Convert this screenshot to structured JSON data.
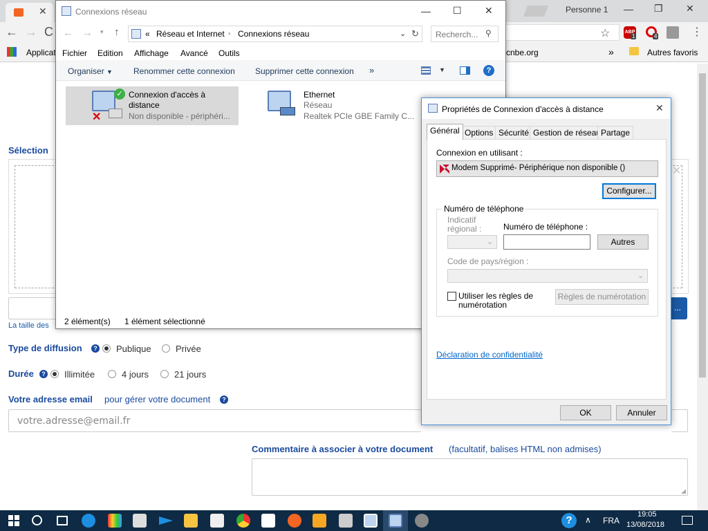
{
  "browser": {
    "profile_name": "Personne 1",
    "bookmarks": {
      "apps_label": "Applicat",
      "partial_bookmark": "cnbe.org",
      "more_chevron": "»",
      "other_bookmarks": "Autres favoris"
    },
    "extensions": {
      "abp_label": "ABP",
      "abp_badge": "1",
      "ext2_badge": "4"
    }
  },
  "webpage": {
    "select_label_partial": "Sélection",
    "size_note_partial": "La taille des",
    "browse_button_partial": "...",
    "diffusion": {
      "label": "Type de diffusion",
      "options": [
        "Publique",
        "Privée"
      ],
      "selected": "Publique"
    },
    "duration": {
      "label": "Durée",
      "options": [
        "Illimitée",
        "4 jours",
        "21 jours"
      ],
      "selected": "Illimitée"
    },
    "email": {
      "label": "Votre adresse email",
      "label_suffix": "pour gérer votre document",
      "placeholder": "votre.adresse@email.fr"
    },
    "comment": {
      "label": "Commentaire à associer à votre document",
      "label_suffix": "(facultatif, balises HTML non admises)"
    }
  },
  "explorer": {
    "title": "Connexions réseau",
    "breadcrumb": {
      "overflow": "«",
      "parts": [
        "Réseau et Internet",
        "Connexions réseau"
      ]
    },
    "search_placeholder": "Recherch...",
    "menu": [
      "Fichier",
      "Edition",
      "Affichage",
      "Avancé",
      "Outils"
    ],
    "commands": {
      "organize": "Organiser",
      "rename": "Renommer cette connexion",
      "delete": "Supprimer cette connexion",
      "more": "»"
    },
    "items": [
      {
        "title_line1": "Connexion d'accès à",
        "title_line2": "distance",
        "status": "Non disponible - périphéri..."
      },
      {
        "title_line1": "Ethernet",
        "status": "Réseau",
        "device": "Realtek PCIe GBE Family C..."
      }
    ],
    "status_bar": {
      "count": "2 élément(s)",
      "selected": "1 élément sélectionné"
    }
  },
  "dialog": {
    "title": "Propriétés de Connexion d'accès à distance",
    "tabs": [
      "Général",
      "Options",
      "Sécurité",
      "Gestion de réseau",
      "Partage"
    ],
    "active_tab": "Général",
    "connect_using_label": "Connexion en utilisant :",
    "device": "Modem Supprimé- Périphérique non disponible ()",
    "configure_button": "Configurer...",
    "phone_group": {
      "legend": "Numéro de téléphone",
      "area_code_label_line1": "Indicatif",
      "area_code_label_line2": "régional :",
      "phone_label": "Numéro de téléphone :",
      "phone_value": "",
      "others_button": "Autres",
      "country_label": "Code de pays/région :",
      "use_rules_line1": "Utiliser les règles de",
      "use_rules_line2": "numérotation",
      "use_rules_checked": false,
      "rules_button": "Règles de numérotation"
    },
    "privacy_link": "Déclaration de confidentialité",
    "ok_button": "OK",
    "cancel_button": "Annuler"
  },
  "taskbar": {
    "language": "FRA",
    "time": "19:05",
    "date": "13/08/2018"
  }
}
